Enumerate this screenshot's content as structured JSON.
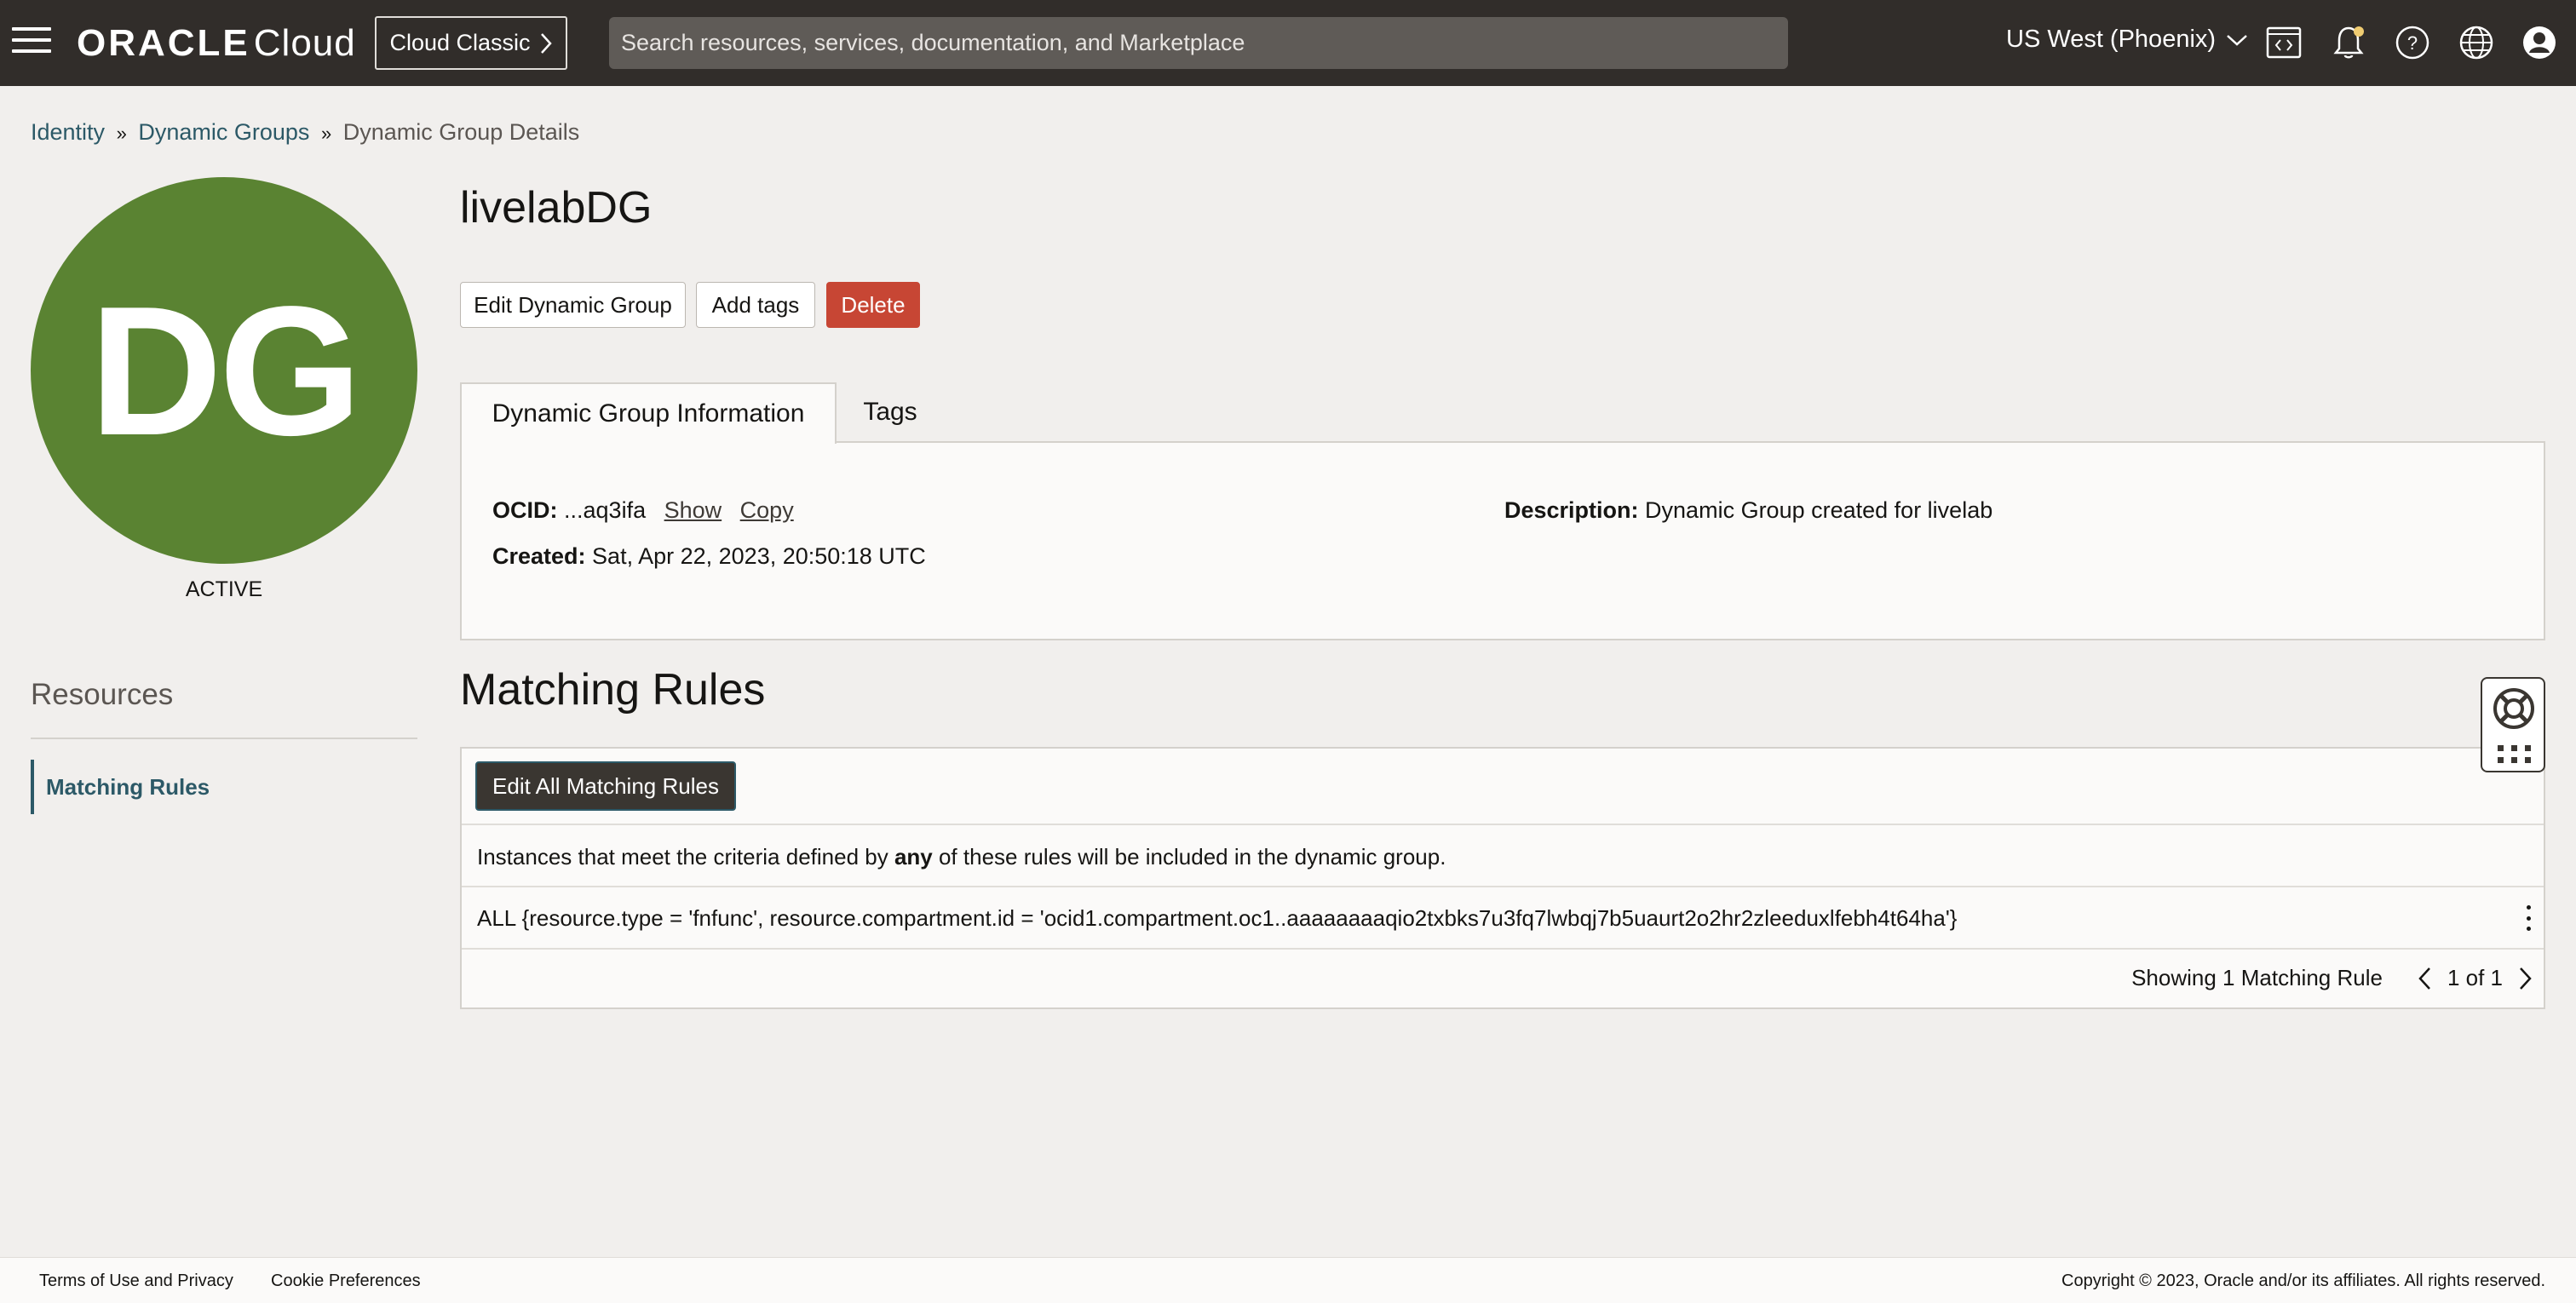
{
  "topbar": {
    "brand_oracle": "ORACLE",
    "brand_cloud": "Cloud",
    "classic_label": "Cloud Classic",
    "search_placeholder": "Search resources, services, documentation, and Marketplace",
    "region": "US West (Phoenix)",
    "icons": [
      "menu-icon",
      "code-editor-icon",
      "bell-icon",
      "help-icon",
      "globe-icon",
      "user-icon"
    ]
  },
  "breadcrumb": {
    "items": [
      "Identity",
      "Dynamic Groups",
      "Dynamic Group Details"
    ],
    "separator": "»"
  },
  "avatar": {
    "initials": "DG",
    "status": "ACTIVE",
    "color": "#5a8332"
  },
  "resources": {
    "title": "Resources",
    "items": [
      "Matching Rules"
    ]
  },
  "group": {
    "name": "livelabDG"
  },
  "actions": {
    "edit": "Edit Dynamic Group",
    "add_tags": "Add tags",
    "delete": "Delete"
  },
  "tabs": [
    "Dynamic Group Information",
    "Tags"
  ],
  "info": {
    "ocid_label": "OCID:",
    "ocid_value": "...aq3ifa",
    "show": "Show",
    "copy": "Copy",
    "created_label": "Created:",
    "created_value": "Sat, Apr 22, 2023, 20:50:18 UTC",
    "description_label": "Description:",
    "description_value": "Dynamic Group created for livelab"
  },
  "matching_rules": {
    "title": "Matching Rules",
    "edit_button": "Edit All Matching Rules",
    "desc_before": "Instances that meet the criteria defined by ",
    "desc_bold": "any",
    "desc_after": " of these rules will be included in the dynamic group.",
    "rules": [
      "ALL {resource.type = 'fnfunc', resource.compartment.id = 'ocid1.compartment.oc1..aaaaaaaaqio2txbks7u3fq7lwbqj7b5uaurt2o2hr2zleeduxlfebh4t64ha'}"
    ],
    "showing": "Showing 1 Matching Rule",
    "page": "1 of 1"
  },
  "footer": {
    "terms": "Terms of Use and Privacy",
    "cookies": "Cookie Preferences",
    "copyright": "Copyright © 2023, Oracle and/or its affiliates. All rights reserved."
  },
  "colors": {
    "topbar": "#312d2a",
    "delete": "#c74634",
    "link": "#2c5967"
  }
}
